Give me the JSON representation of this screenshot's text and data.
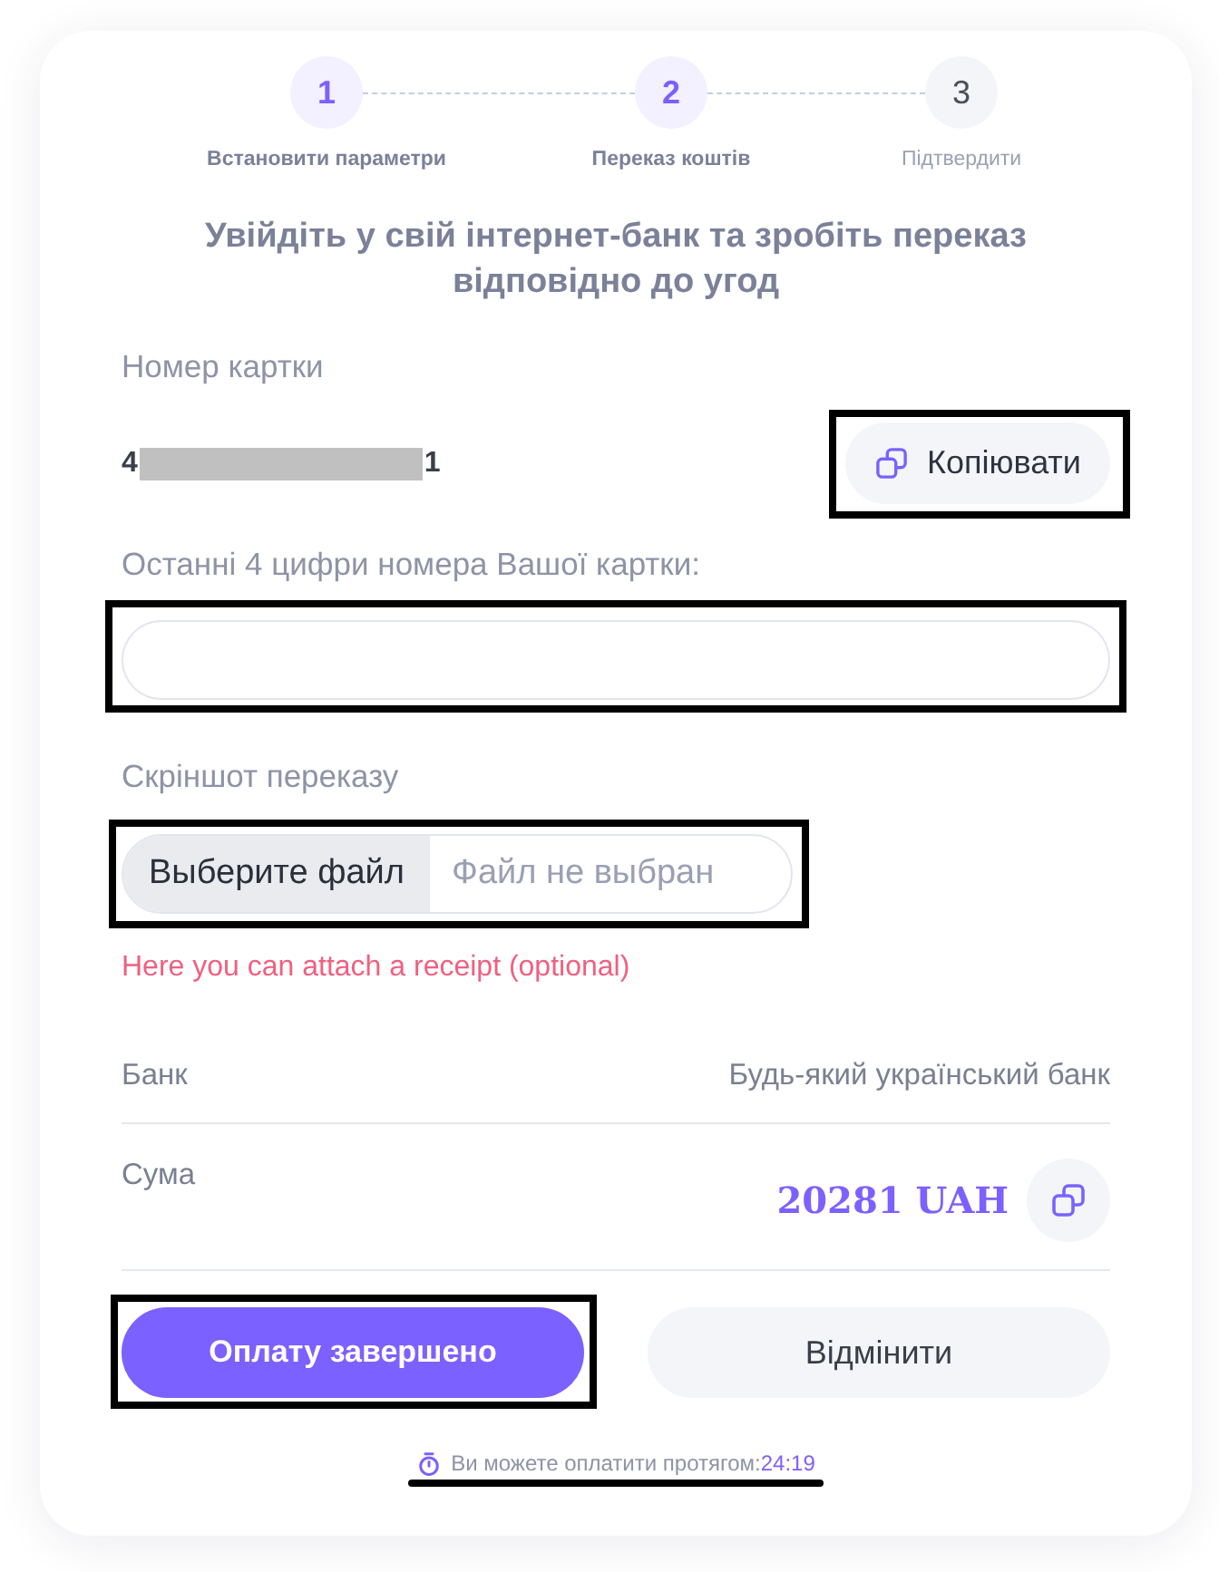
{
  "steps": [
    {
      "number": "1",
      "label": "Встановити параметри",
      "active": true
    },
    {
      "number": "2",
      "label": "Переказ коштів",
      "active": true
    },
    {
      "number": "3",
      "label": "Підтвердити",
      "active": false
    }
  ],
  "title": "Увійдіть у свій інтернет-банк та зробіть переказ відповідно до угод",
  "card_number": {
    "label": "Номер картки",
    "first_digit": "4",
    "last_digit": "1",
    "masked": true,
    "copy_button": {
      "label": "Копіювати",
      "highlighted": true
    }
  },
  "last_digits_field": {
    "label": "Останні 4 цифри номера Вашої картки:",
    "highlighted": true
  },
  "file_upload": {
    "label": "Скріншот переказу",
    "button": "Выберите файл",
    "status": "Файл не выбран",
    "highlighted": true,
    "hint": "Here you can attach a receipt (optional)"
  },
  "details": [
    {
      "kind": "text",
      "label": "Банк",
      "value": "Будь-який український банк"
    },
    {
      "kind": "amount",
      "label": "Сума",
      "value": "20281 UAH"
    }
  ],
  "buttons": [
    {
      "kind": "primary",
      "label": "Оплату завершено",
      "highlighted": true
    },
    {
      "kind": "secondary",
      "label": "Відмінити",
      "highlighted": false
    }
  ],
  "timer": {
    "label": "Ви можете оплатити протягом:",
    "time": "24:19",
    "underlined": true
  }
}
